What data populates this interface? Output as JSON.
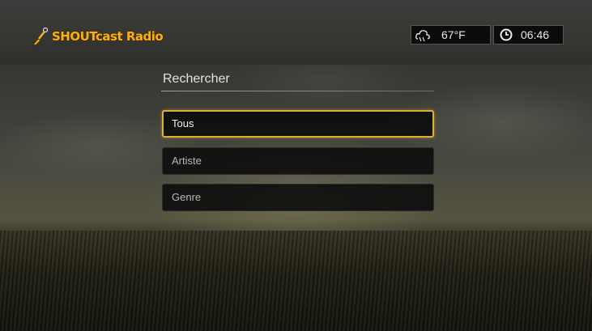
{
  "app": {
    "logo_text": "SHOUTcast Radio",
    "logo_icon": "guitar-icon",
    "accent_color": "#f2b21c"
  },
  "status": {
    "weather_icon": "weather-cloud-icon",
    "temperature": "67°F",
    "clock_icon": "clock-icon",
    "time": "06:46"
  },
  "search": {
    "title": "Rechercher",
    "options": [
      {
        "label": "Tous",
        "selected": true
      },
      {
        "label": "Artiste",
        "selected": false
      },
      {
        "label": "Genre",
        "selected": false
      }
    ],
    "selection_color": "#d9b232"
  }
}
